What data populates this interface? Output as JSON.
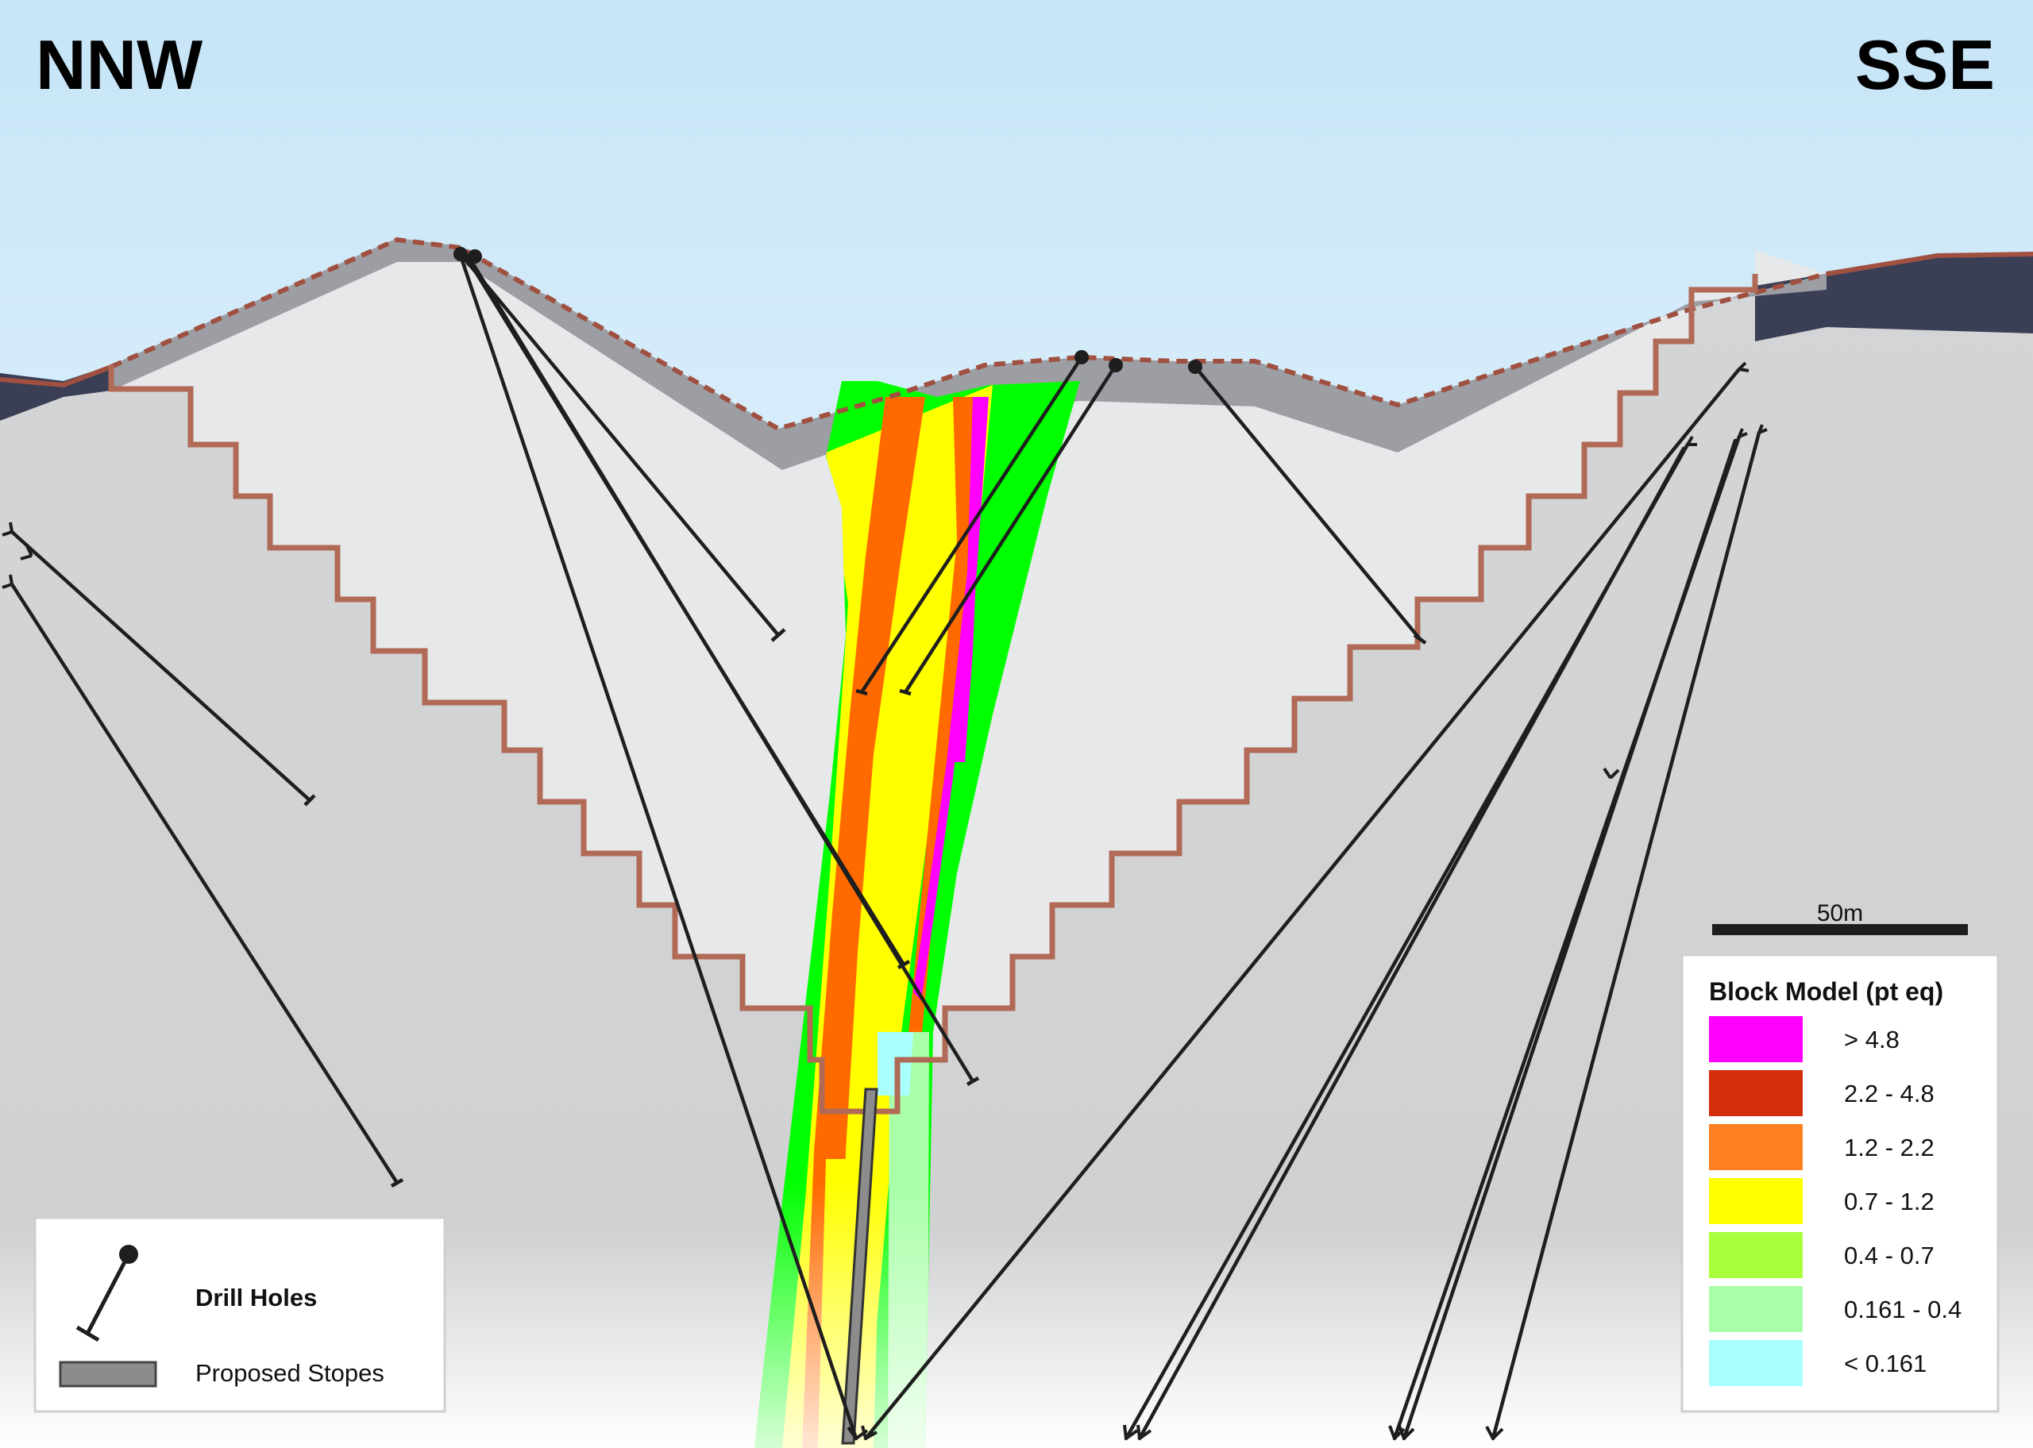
{
  "directions": {
    "left": "NNW",
    "right": "SSE"
  },
  "scale_bar": {
    "label": "50m"
  },
  "legend_symbols": {
    "items": [
      {
        "label": "Drill Holes",
        "icon": "drill-hole-icon"
      },
      {
        "label": "Proposed Stopes",
        "icon": "stope-icon"
      }
    ]
  },
  "block_model_legend": {
    "title": "Block Model (pt eq)",
    "items": [
      {
        "label": "> 4.8",
        "color": "#ff00ff"
      },
      {
        "label": "2.2 - 4.8",
        "color": "#d42e0a"
      },
      {
        "label": "1.2 - 2.2",
        "color": "#ff8020"
      },
      {
        "label": "0.7 - 1.2",
        "color": "#ffff00"
      },
      {
        "label": "0.4 - 0.7",
        "color": "#a8ff3c"
      },
      {
        "label": "0.161 - 0.4",
        "color": "#a8ffa8"
      },
      {
        "label": "< 0.161",
        "color": "#aaffff"
      }
    ]
  },
  "colors": {
    "sky_top": "#c9e6f8",
    "pit_outline": "#b06a55",
    "topography": "#a05040",
    "drill_hole": "#1e1e1e",
    "stope": "#8c8c8c"
  }
}
